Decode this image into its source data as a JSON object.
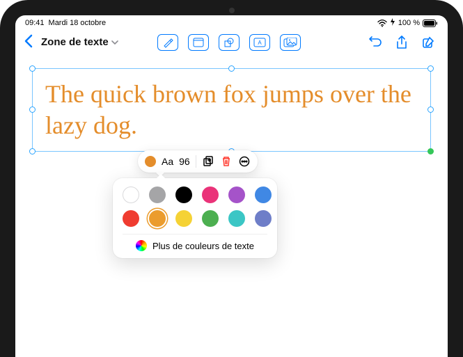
{
  "status": {
    "time": "09:41",
    "date": "Mardi 18 octobre",
    "battery": "100 %"
  },
  "header": {
    "title": "Zone de texte"
  },
  "textbox": {
    "content": "The quick brown fox jumps over the lazy dog."
  },
  "format_bar": {
    "font_label": "Aa",
    "font_size": "96"
  },
  "color_popover": {
    "more_label": "Plus de couleurs de texte",
    "swatches_row1": [
      "#ffffff",
      "#a5a5a7",
      "#000000",
      "#ea3379",
      "#a553c9",
      "#4088e4"
    ],
    "swatches_row2": [
      "#ef3c30",
      "#eb9c2d",
      "#f5d235",
      "#4caf50",
      "#3bc6c5",
      "#6e7ec8"
    ],
    "selected": "#eb9c2d"
  }
}
